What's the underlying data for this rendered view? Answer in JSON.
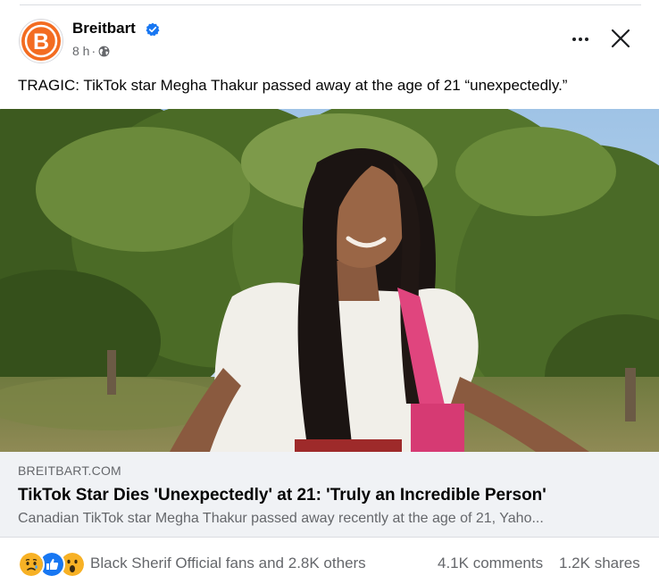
{
  "post": {
    "author": "Breitbart",
    "time": "8 h",
    "separator": "·",
    "caption": "TRAGIC: TikTok star Megha Thakur passed away at the age of 21 “unexpectedly.”",
    "logo_letter": "B"
  },
  "link_preview": {
    "domain": "BREITBART.COM",
    "title": "TikTok Star Dies 'Unexpectedly' at 21: 'Truly an Incredible Person'",
    "description": "Canadian TikTok star Megha Thakur passed away recently at the age of 21, Yaho..."
  },
  "footer": {
    "reaction_text": "Black Sherif Official fans and 2.8K others",
    "comments": "4.1K comments",
    "shares": "1.2K shares",
    "reactions": [
      "sad-reaction-icon",
      "like-reaction-icon",
      "wow-reaction-icon"
    ]
  },
  "colors": {
    "brand_orange": "#f36c21",
    "verified_blue": "#1877f2",
    "like_blue": "#1877f2",
    "emoji_yellow": "#f7b125"
  },
  "icons": {
    "more": "more-options-icon",
    "close": "close-icon",
    "globe": "globe-icon",
    "verified": "verified-badge-icon"
  }
}
